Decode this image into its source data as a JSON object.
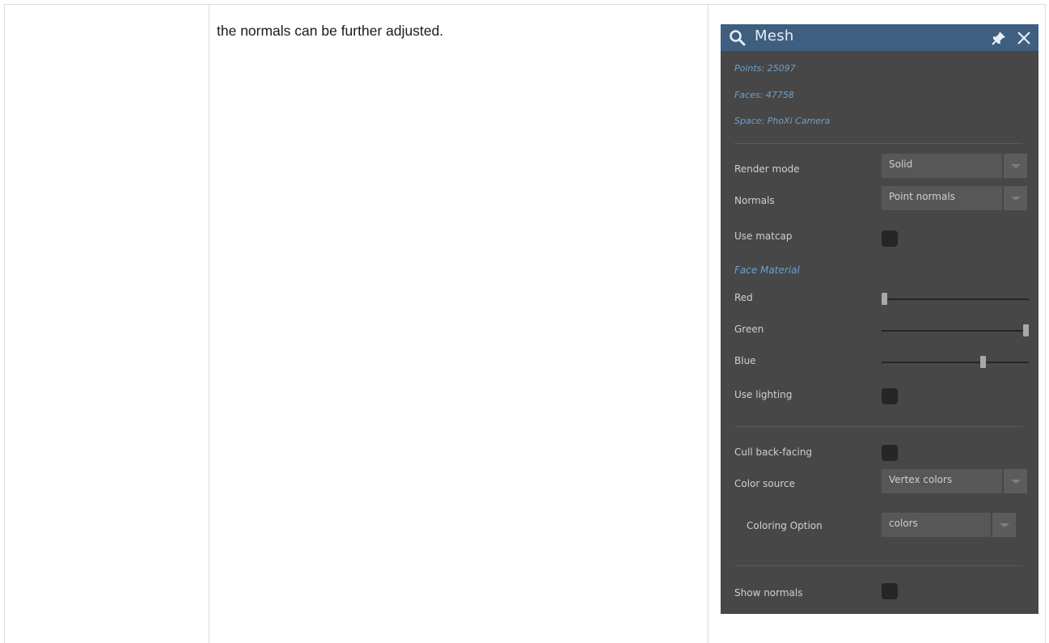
{
  "document": {
    "description": "the normals can be further adjusted."
  },
  "panel": {
    "title": "Mesh",
    "icons": {
      "search": "search-icon",
      "pin": "pin-icon",
      "close": "close-icon"
    },
    "info": {
      "points": "Points: 25097",
      "faces": "Faces: 47758",
      "space": "Space: PhoXi Camera"
    },
    "render_mode": {
      "label": "Render mode",
      "value": "Solid"
    },
    "normals": {
      "label": "Normals",
      "value": "Point normals"
    },
    "use_matcap": {
      "label": "Use matcap",
      "checked": false
    },
    "face_material": {
      "title": "Face Material",
      "red": {
        "label": "Red",
        "value": 0.0
      },
      "green": {
        "label": "Green",
        "value": 1.0
      },
      "blue": {
        "label": "Blue",
        "value": 0.7
      }
    },
    "use_lighting": {
      "label": "Use lighting",
      "checked": false
    },
    "cull_back_facing": {
      "label": "Cull back-facing",
      "checked": false
    },
    "color_source": {
      "label": "Color source",
      "value": "Vertex colors"
    },
    "coloring_option": {
      "label": "Coloring Option",
      "value": "colors"
    },
    "show_normals": {
      "label": "Show normals",
      "checked": false
    }
  },
  "colors": {
    "panel_bg": "#474747",
    "header_bg": "#3e5f80",
    "info_text": "#6e9fcc",
    "label_text": "#cfcfcf"
  }
}
